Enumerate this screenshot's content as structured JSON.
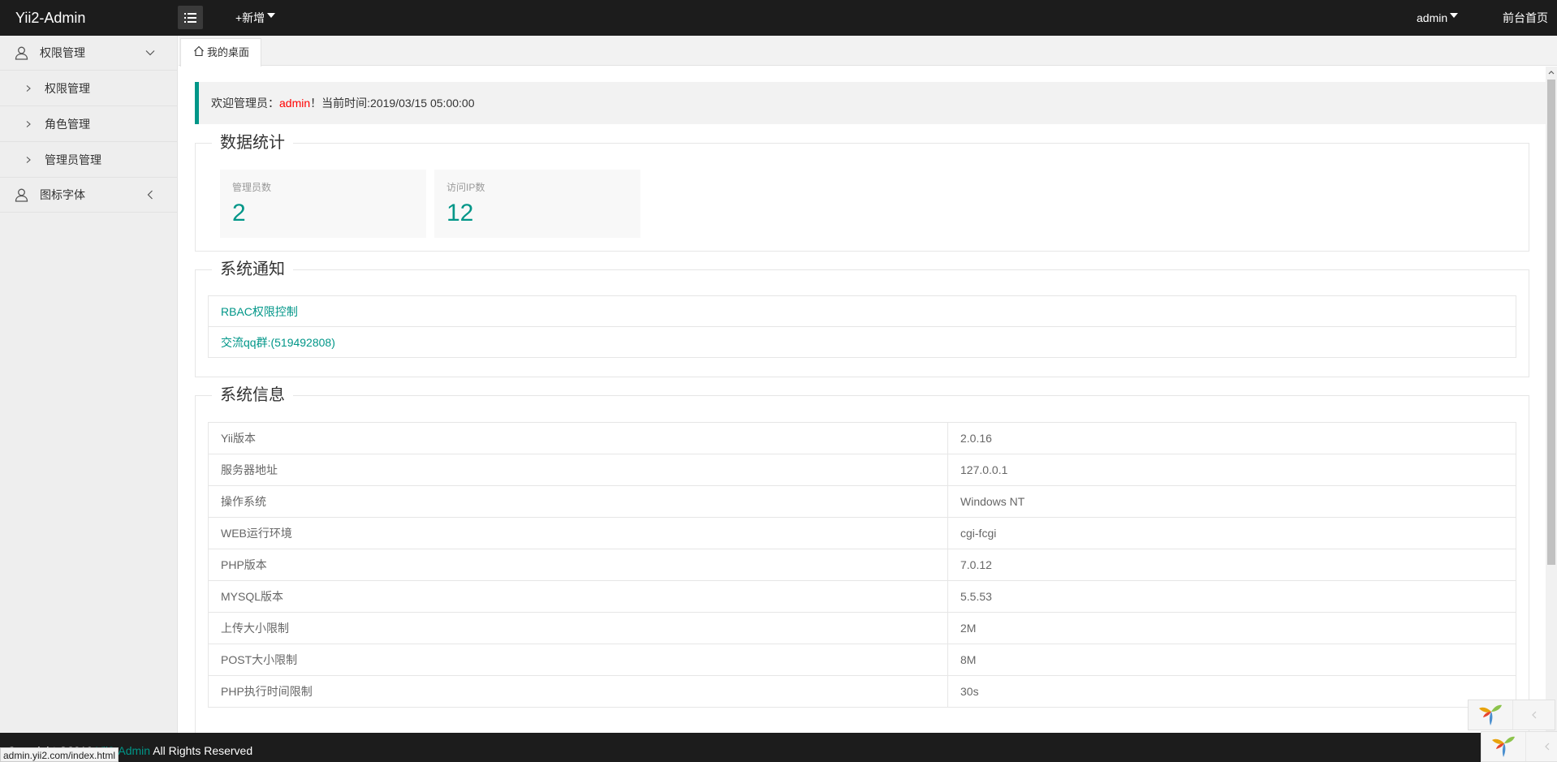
{
  "header": {
    "brand": "Yii2-Admin",
    "add_label": "+新增",
    "user_label": "admin",
    "home_label": "前台首页"
  },
  "sidebar": {
    "groups": [
      {
        "label": "权限管理",
        "icon": "user-icon",
        "expanded": true,
        "children": [
          "权限管理",
          "角色管理",
          "管理员管理"
        ]
      },
      {
        "label": "图标字体",
        "icon": "user-icon",
        "expanded": false,
        "children": []
      }
    ]
  },
  "tabs": [
    {
      "label": "我的桌面",
      "icon": "home-icon",
      "active": true
    }
  ],
  "welcome": {
    "prefix": "欢迎管理员：",
    "admin": "admin",
    "suffix": "！当前时间:2019/03/15 05:00:00"
  },
  "stats": {
    "title": "数据统计",
    "cards": [
      {
        "label": "管理员数",
        "value": "2"
      },
      {
        "label": "访问IP数",
        "value": "12"
      }
    ]
  },
  "notices": {
    "title": "系统通知",
    "items": [
      "RBAC权限控制",
      "交流qq群:(519492808)"
    ]
  },
  "sysinfo": {
    "title": "系统信息",
    "rows": [
      {
        "key": "Yii版本",
        "value": "2.0.16"
      },
      {
        "key": "服务器地址",
        "value": "127.0.0.1"
      },
      {
        "key": "操作系统",
        "value": "Windows NT"
      },
      {
        "key": "WEB运行环境",
        "value": "cgi-fcgi"
      },
      {
        "key": "PHP版本",
        "value": "7.0.12"
      },
      {
        "key": "MYSQL版本",
        "value": "5.5.53"
      },
      {
        "key": "上传大小限制",
        "value": "2M"
      },
      {
        "key": "POST大小限制",
        "value": "8M"
      },
      {
        "key": "PHP执行时间限制",
        "value": "30s"
      }
    ]
  },
  "footer": {
    "prefix": "Copyright ©2019 ",
    "brand": "Yii2-Admin",
    "suffix": " All Rights Reserved"
  },
  "status_url": "admin.yii2.com/index.html",
  "colors": {
    "accent": "#009688",
    "header_bg": "#1c1c1c",
    "admin_name": "#ff0000",
    "sidebar_bg": "#eeeeee"
  }
}
